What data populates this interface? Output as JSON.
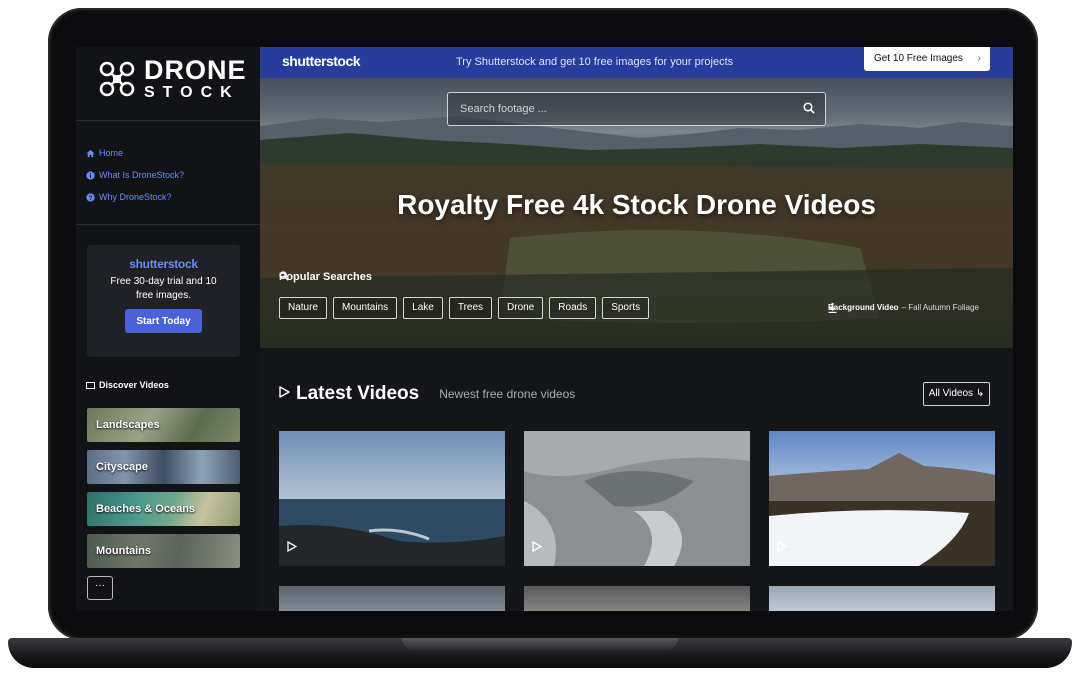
{
  "brand": {
    "logo_line1": "DRONE",
    "logo_line2": "STOCK"
  },
  "sidebar": {
    "nav": [
      {
        "label": "Home",
        "icon": "home-icon"
      },
      {
        "label": "What Is DroneStock?",
        "icon": "info-icon"
      },
      {
        "label": "Why DroneStock?",
        "icon": "question-icon"
      }
    ],
    "promo": {
      "brand": "shutterstock",
      "text": "Free 30-day trial and 10 free images.",
      "button": "Start Today"
    },
    "discover_label": "Discover Videos",
    "categories": [
      "Landscapes",
      "Cityscape",
      "Beaches & Oceans",
      "Mountains"
    ],
    "more_label": "···"
  },
  "banner": {
    "brand": "shutterstock",
    "message": "Try Shutterstock and get 10 free images for your projects",
    "button": "Get 10 Free Images"
  },
  "hero": {
    "search_placeholder": "Search footage ...",
    "title": "Royalty Free 4k Stock Drone Videos",
    "popular_label": "Popular Searches",
    "tags": [
      "Nature",
      "Mountains",
      "Lake",
      "Trees",
      "Drone",
      "Roads",
      "Sports"
    ],
    "bg_label": "Background Video",
    "bg_name": "– Fall Autumn Foliage"
  },
  "latest": {
    "title": "Latest Videos",
    "subtitle": "Newest free drone videos",
    "all_button": "All Videos ↳"
  },
  "colors": {
    "accent": "#4963d6",
    "banner": "#283c9c",
    "link": "#6a8cf5",
    "sidebar": "#121316",
    "page": "#15161a"
  }
}
